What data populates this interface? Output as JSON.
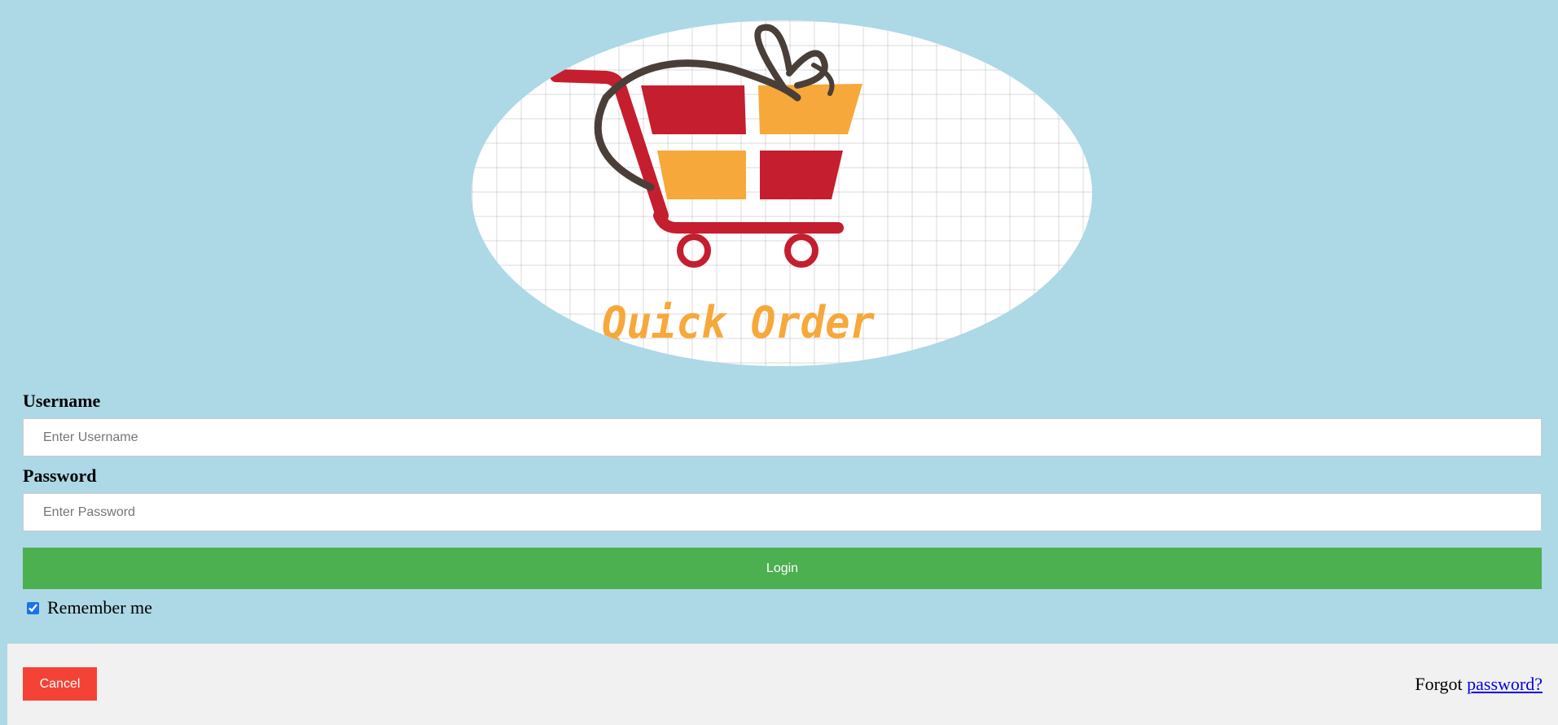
{
  "logo": {
    "text": "Quick Order",
    "icon": "shopping-cart-gift-icon",
    "colors": {
      "red": "#c41e2f",
      "orange": "#f7a83a",
      "ribbon": "#4a3f38"
    }
  },
  "form": {
    "username": {
      "label": "Username",
      "placeholder": "Enter Username",
      "value": ""
    },
    "password": {
      "label": "Password",
      "placeholder": "Enter Password",
      "value": ""
    },
    "login_label": "Login",
    "remember": {
      "label": "Remember me",
      "checked": true
    }
  },
  "footer": {
    "cancel_label": "Cancel",
    "forgot_prefix": "Forgot ",
    "forgot_link": "password?"
  },
  "colors": {
    "page_background": "#add8e6",
    "login_button": "#4caf50",
    "cancel_button": "#f44336",
    "footer_background": "#f1f1f1",
    "link": "#0000ee"
  }
}
